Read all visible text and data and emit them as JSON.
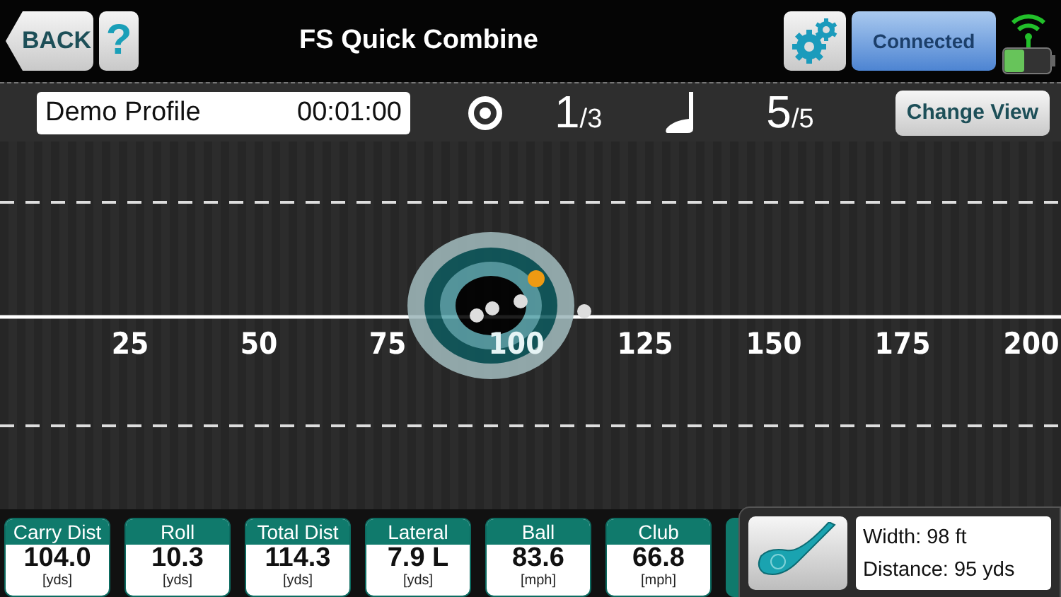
{
  "header": {
    "back": "BACK",
    "help": "?",
    "title": "FS Quick Combine",
    "connection": "Connected"
  },
  "session": {
    "profile": "Demo Profile",
    "time": "00:01:00",
    "target_count": "1",
    "target_total": "/3",
    "shot_count": "5",
    "shot_total": "/5",
    "change_view": "Change View"
  },
  "range": {
    "distance_labels": [
      "25",
      "50",
      "75",
      "100",
      "125",
      "150",
      "175",
      "200"
    ]
  },
  "stats": [
    {
      "label": "Carry Dist",
      "value": "104.0",
      "unit": "[yds]"
    },
    {
      "label": "Roll",
      "value": "10.3",
      "unit": "[yds]"
    },
    {
      "label": "Total Dist",
      "value": "114.3",
      "unit": "[yds]"
    },
    {
      "label": "Lateral",
      "value": "7.9 L",
      "unit": "[yds]"
    },
    {
      "label": "Ball",
      "value": "83.6",
      "unit": "[mph]"
    },
    {
      "label": "Club",
      "value": "66.8",
      "unit": "[mph]"
    }
  ],
  "target_info": {
    "width": "Width: 98 ft",
    "distance": "Distance: 95 yds"
  }
}
